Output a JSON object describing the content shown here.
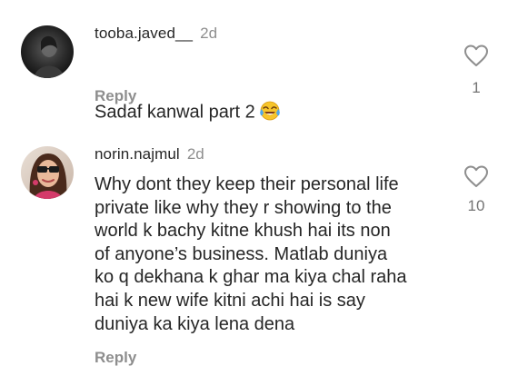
{
  "comments": [
    {
      "username": "tooba.javed__",
      "time": "2d",
      "text": "Sadaf kanwal part 2",
      "emoji": "face-with-tears-of-joy",
      "reply_label": "Reply",
      "like_count": "1"
    },
    {
      "username": "norin.najmul",
      "time": "2d",
      "text": "Why dont they keep their personal life\nprivate like why they r showing to the\nworld k bachy kitne khush hai its non\nof anyone’s business. Matlab duniya\nko q dekhana k ghar ma kiya chal raha\nhai k new wife kitni achi hai is say\nduniya ka kiya lena dena",
      "reply_label": "Reply",
      "like_count": "10"
    }
  ],
  "colors": {
    "text": "#262626",
    "secondary": "#8e8e8e",
    "background": "#ffffff"
  },
  "icons": {
    "like": "heart-outline-icon",
    "emoji": "face-with-tears-of-joy-icon"
  }
}
